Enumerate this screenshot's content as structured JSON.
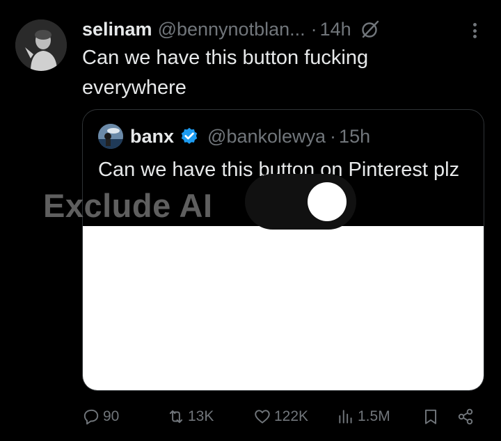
{
  "tweet": {
    "author_name": "selinam",
    "author_handle": "@bennynotblan...",
    "separator": "·",
    "time": "14h",
    "text": "Can we have this button fucking everywhere"
  },
  "quote": {
    "author_name": "banx",
    "author_handle": "@bankolewya",
    "separator": "·",
    "time": "15h",
    "text": "Can we have this button on Pinterest plz",
    "media": {
      "label": "Exclude AI",
      "toggle_state": "on"
    }
  },
  "actions": {
    "replies": "90",
    "reposts": "13K",
    "likes": "122K",
    "views": "1.5M"
  },
  "colors": {
    "background": "#000000",
    "text_primary": "#e7e9ea",
    "text_secondary": "#71767b",
    "verified": "#1d9bf0",
    "border": "#2f3336"
  },
  "icons": {
    "grok": "grok-icon",
    "more": "more-icon",
    "verified": "verified-badge-icon",
    "reply": "reply-icon",
    "repost": "repost-icon",
    "like": "heart-icon",
    "views": "views-icon",
    "bookmark": "bookmark-icon",
    "share": "share-icon"
  }
}
